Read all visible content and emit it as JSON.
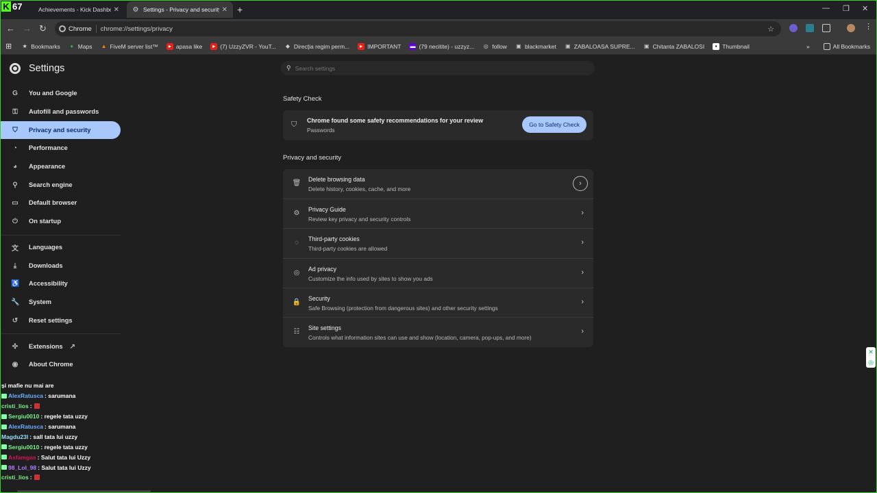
{
  "overlay": {
    "kick_logo": "K",
    "kick_count": "67"
  },
  "tabs": [
    {
      "label": "Achievements - Kick Dashboard",
      "icon": "kick-icon"
    },
    {
      "label": "Settings - Privacy and security",
      "icon": "gear-icon"
    }
  ],
  "toolbar": {
    "chip_label": "Chrome",
    "url": "chrome://settings/privacy"
  },
  "bookmarks": {
    "items": [
      {
        "label": "Bookmarks",
        "icon": "star-icon"
      },
      {
        "label": "Maps",
        "icon": "maps-icon"
      },
      {
        "label": "FiveM server list™",
        "icon": "fivem-icon"
      },
      {
        "label": "apasa like",
        "icon": "youtube-icon"
      },
      {
        "label": "(7) UzzyZVR - YouT...",
        "icon": "youtube-icon"
      },
      {
        "label": "Direcţia regim perm...",
        "icon": "gov-icon"
      },
      {
        "label": "IMPORTANT",
        "icon": "youtube-icon"
      },
      {
        "label": "(79 necitite) - uzzyz...",
        "icon": "yahoo-icon"
      },
      {
        "label": "follow",
        "icon": "link-icon"
      },
      {
        "label": "blackmarket",
        "icon": "app-icon"
      },
      {
        "label": "ZABALOASA SUPRE...",
        "icon": "app-icon"
      },
      {
        "label": "Chitanta ZABALOSI",
        "icon": "app-icon"
      },
      {
        "label": "Thumbnail",
        "icon": "app-icon"
      }
    ],
    "all_bookmarks": "All Bookmarks"
  },
  "sidebar": {
    "title": "Settings",
    "items": [
      {
        "label": "You and Google",
        "icon": "google-icon"
      },
      {
        "label": "Autofill and passwords",
        "icon": "key-icon"
      },
      {
        "label": "Privacy and security",
        "icon": "shield-icon"
      },
      {
        "label": "Performance",
        "icon": "speedometer-icon"
      },
      {
        "label": "Appearance",
        "icon": "palette-icon"
      },
      {
        "label": "Search engine",
        "icon": "search-icon"
      },
      {
        "label": "Default browser",
        "icon": "browser-icon"
      },
      {
        "label": "On startup",
        "icon": "power-icon"
      },
      {
        "label": "Languages",
        "icon": "translate-icon"
      },
      {
        "label": "Downloads",
        "icon": "download-icon"
      },
      {
        "label": "Accessibility",
        "icon": "accessibility-icon"
      },
      {
        "label": "System",
        "icon": "wrench-icon"
      },
      {
        "label": "Reset settings",
        "icon": "reset-icon"
      },
      {
        "label": "Extensions",
        "icon": "puzzle-icon"
      },
      {
        "label": "About Chrome",
        "icon": "chrome-icon"
      }
    ],
    "active": "Privacy and security"
  },
  "search": {
    "placeholder": "Search settings"
  },
  "safety_check": {
    "section_title": "Safety Check",
    "title": "Chrome found some safety recommendations for your review",
    "subtitle": "Passwords",
    "button": "Go to Safety Check"
  },
  "privacy": {
    "section_title": "Privacy and security",
    "rows": [
      {
        "title": "Delete browsing data",
        "subtitle": "Delete history, cookies, cache, and more",
        "icon": "trash-icon"
      },
      {
        "title": "Privacy Guide",
        "subtitle": "Review key privacy and security controls",
        "icon": "guide-icon"
      },
      {
        "title": "Third-party cookies",
        "subtitle": "Third-party cookies are allowed",
        "icon": "cookie-icon"
      },
      {
        "title": "Ad privacy",
        "subtitle": "Customize the info used by sites to show you ads",
        "icon": "ad-privacy-icon"
      },
      {
        "title": "Security",
        "subtitle": "Safe Browsing (protection from dangerous sites) and other security settings",
        "icon": "lock-icon"
      },
      {
        "title": "Site settings",
        "subtitle": "Controls what information sites can use and show (location, camera, pop-ups, and more)",
        "icon": "sliders-icon"
      }
    ]
  },
  "chat": [
    {
      "user": "",
      "color": "#ffffff",
      "message": "și mafie nu mai are",
      "badge": false,
      "emote": false
    },
    {
      "user": "AlexRatusca",
      "color": "#6ab0ff",
      "message": ": sarumana",
      "badge": true,
      "emote": false
    },
    {
      "user": "cristi_lios",
      "color": "#7cf28c",
      "message": ":",
      "badge": false,
      "emote": true
    },
    {
      "user": "Sergiu0010",
      "color": "#7cf28c",
      "message": ": regele tata uzzy",
      "badge": true,
      "emote": false
    },
    {
      "user": "AlexRatusca",
      "color": "#6ab0ff",
      "message": ": sarumana",
      "badge": true,
      "emote": false
    },
    {
      "user": "Magdu23l",
      "color": "#9adfff",
      "message": ": sall tata lui uzzy",
      "badge": false,
      "emote": false
    },
    {
      "user": "Sergiu0010",
      "color": "#7cf28c",
      "message": ": regele tata uzzy",
      "badge": true,
      "emote": false
    },
    {
      "user": "Asfamgas",
      "color": "#d4145a",
      "message": ": Salut tata lui Uzzy",
      "badge": true,
      "emote": false
    },
    {
      "user": "98_Lol_98",
      "color": "#b57cff",
      "message": ": Salut tata lui Uzzy",
      "badge": true,
      "emote": false
    },
    {
      "user": "cristi_lios",
      "color": "#7cf28c",
      "message": ":",
      "badge": false,
      "emote": true
    }
  ]
}
